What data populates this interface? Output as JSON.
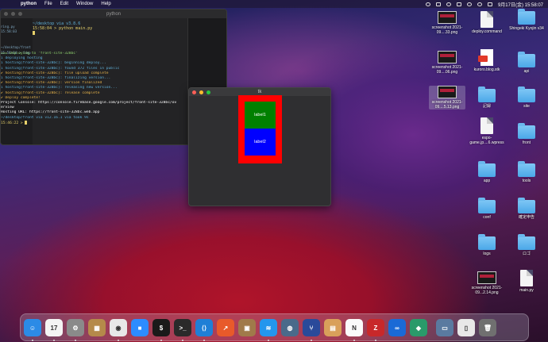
{
  "menubar": {
    "app_name": "python",
    "items": [
      "File",
      "Edit",
      "Window",
      "Help"
    ],
    "clock": "9月17日(金)  15:58:07"
  },
  "terminal": {
    "window_title": "python",
    "left_pane": [
      "ring.py",
      "15:58:03",
      "~/desktop/front",
      "15:58:04 > fdep"
    ],
    "top_lines": [
      "~/desktop via  v3.8.6",
      "15:58:04 > python main.py"
    ],
    "log_lines": [
      "=== Deploying to 'front-site-328bc'",
      "",
      "i  deploying hosting",
      "i  hosting[front-site-328bc]: beginning deploy...",
      "i  hosting[front-site-328bc]: found 372 files in public",
      "✔  hosting[front-site-328bc]: file upload complete",
      "i  hosting[front-site-328bc]: finalizing version...",
      "✔  hosting[front-site-328bc]: version finalized",
      "i  hosting[front-site-328bc]: releasing new version...",
      "✔  hosting[front-site-328bc]: release complete",
      "",
      "✔  Deploy complete!",
      "",
      "Project Console: https://console.firebase.google.com/project/front-site-328bc/ov",
      "erview",
      "Hosting URL: https://front-site-328bc.web.app",
      "~/desktop/front via  v12.16.1 via  took 9s",
      "15:46:22 > "
    ]
  },
  "tk_window": {
    "title": "tk",
    "label1": "label1",
    "label2": "label2"
  },
  "desktop_icons": [
    {
      "label": "screenshot 2021-09....33.png",
      "kind": "screenshot"
    },
    {
      "label": "deploy.command",
      "kind": "doc"
    },
    {
      "label": "Shingeki Kyojin v34",
      "kind": "folder"
    },
    {
      "label": "screenshot 2021-09....06.png",
      "kind": "screenshot"
    },
    {
      "label": "kuroro.blog.stk",
      "kind": "pdf"
    },
    {
      "label": "api",
      "kind": "folder"
    },
    {
      "label": "screenshot 2021-09....5.13.png",
      "kind": "screenshot"
    },
    {
      "label": "記録",
      "kind": "folder"
    },
    {
      "label": "site",
      "kind": "folder"
    },
    {
      "label": "espo-game.jp....6.wpress",
      "kind": "doc"
    },
    {
      "label": "front",
      "kind": "folder"
    },
    {
      "label": "app",
      "kind": "folder"
    },
    {
      "label": "tools",
      "kind": "folder"
    },
    {
      "label": "conf",
      "kind": "folder"
    },
    {
      "label": "確定申告",
      "kind": "folder"
    },
    {
      "label": "logs",
      "kind": "folder"
    },
    {
      "label": "ロゴ",
      "kind": "folder"
    },
    {
      "label": "screenshot 2021-09...2.14.png",
      "kind": "screenshot"
    },
    {
      "label": "main.py",
      "kind": "doc"
    }
  ],
  "dock": {
    "apps": [
      {
        "name": "finder",
        "color": "#2b8be6",
        "glyph": "☺"
      },
      {
        "name": "calendar",
        "color": "#f4f4f4",
        "glyph": "17"
      },
      {
        "name": "system-preferences",
        "color": "#8a8a8a",
        "glyph": "⚙"
      },
      {
        "name": "folder-app",
        "color": "#b58a4a",
        "glyph": "▦"
      },
      {
        "name": "chrome",
        "color": "#e8e8e8",
        "glyph": "◉"
      },
      {
        "name": "zoom",
        "color": "#2d8cff",
        "glyph": "■"
      },
      {
        "name": "terminal-green",
        "color": "#1a1a1a",
        "glyph": "$"
      },
      {
        "name": "terminal",
        "color": "#2a2a2a",
        "glyph": ">_"
      },
      {
        "name": "vscode",
        "color": "#1f7fd6",
        "glyph": "⟨⟩"
      },
      {
        "name": "app-orange",
        "color": "#e85a2a",
        "glyph": "↗"
      },
      {
        "name": "archive",
        "color": "#a07a4a",
        "glyph": "▣"
      },
      {
        "name": "docker",
        "color": "#2396ed",
        "glyph": "≋"
      },
      {
        "name": "sequel",
        "color": "#4a6a8a",
        "glyph": "◍"
      },
      {
        "name": "sourcetree",
        "color": "#2a4a9a",
        "glyph": "⑂"
      },
      {
        "name": "app-tan",
        "color": "#d9a05a",
        "glyph": "▤"
      },
      {
        "name": "notion",
        "color": "#fafafa",
        "glyph": "N"
      },
      {
        "name": "filezilla",
        "color": "#c8282a",
        "glyph": "Z"
      },
      {
        "name": "infinity",
        "color": "#1a6ad6",
        "glyph": "∞"
      },
      {
        "name": "vue-app",
        "color": "#2a9a6a",
        "glyph": "◆"
      },
      {
        "name": "preview",
        "color": "#5a7aa0",
        "glyph": "▭"
      },
      {
        "name": "document",
        "color": "#e8e8e8",
        "glyph": "▯"
      },
      {
        "name": "trash",
        "color": "#707070",
        "glyph": "🗑"
      }
    ]
  }
}
